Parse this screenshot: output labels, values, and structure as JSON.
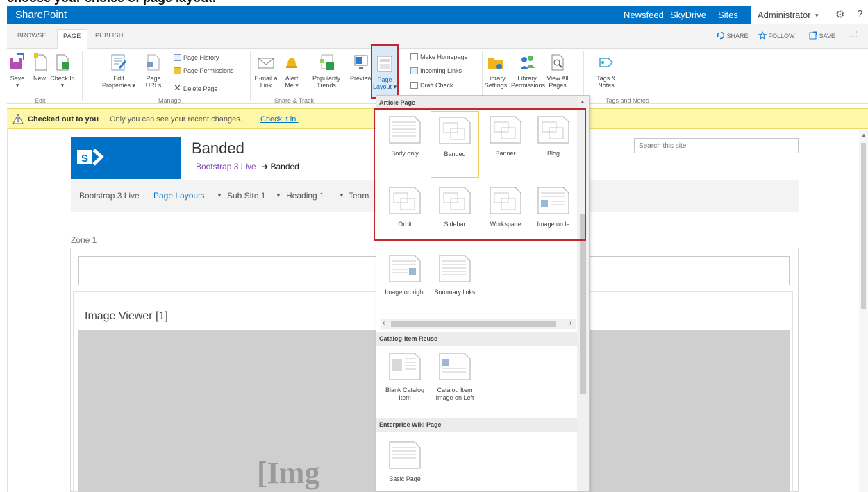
{
  "caption": "choose your choice of page layout.",
  "suite_bar": {
    "brand": "SharePoint",
    "links": [
      "Newsfeed",
      "SkyDrive",
      "Sites"
    ],
    "user": "Administrator",
    "user_caret": "▾",
    "gear": "⚙",
    "help": "?"
  },
  "ribbon_tabs": [
    "BROWSE",
    "PAGE",
    "PUBLISH"
  ],
  "top_actions": {
    "share": "SHARE",
    "follow": "FOLLOW",
    "save": "SAVE"
  },
  "ribbon": {
    "edit_group": {
      "save": "Save",
      "new": "New",
      "check_in": "Check In",
      "label": "Edit"
    },
    "manage_group": {
      "edit_properties": "Edit Properties",
      "page_urls": "Page URLs",
      "page_history": "Page History",
      "page_permissions": "Page Permissions",
      "delete_page": "Delete Page",
      "label": "Manage"
    },
    "share_group": {
      "email_link": "E-mail a Link",
      "alert_me": "Alert Me",
      "popularity_trends": "Popularity Trends",
      "label": "Share & Track"
    },
    "layout_group": {
      "preview": "Preview",
      "page_layout": "Page Layout",
      "make_homepage": "Make Homepage",
      "incoming_links": "Incoming Links",
      "draft_check": "Draft Check"
    },
    "library_group": {
      "library_settings": "Library Settings",
      "library_permissions": "Library Permissions",
      "view_all_pages": "View All Pages"
    },
    "tags_group": {
      "tags_notes": "Tags & Notes",
      "label": "Tags and Notes"
    }
  },
  "status": {
    "title": "Checked out to you",
    "message": "Only you can see your recent changes.",
    "link": "Check it in."
  },
  "site": {
    "title": "Banded",
    "breadcrumb_parent": "Bootstrap 3 Live",
    "breadcrumb_arrow": "➔",
    "breadcrumb_current": "Banded",
    "search_placeholder": "Search this site",
    "nav": [
      "Bootstrap 3 Live",
      "Page Layouts",
      "Sub Site 1",
      "Heading 1",
      "Team"
    ],
    "zone_label": "Zone 1",
    "webpart_title": "Image Viewer [1]",
    "image_placeholder": "[Img"
  },
  "page_layout_menu": {
    "sections": [
      "Article Page",
      "Catalog-Item Reuse",
      "Enterprise Wiki Page"
    ],
    "article_layouts": [
      "Body only",
      "Banded",
      "Banner",
      "Blog",
      "Orbit",
      "Sidebar",
      "Workspace",
      "Image on le",
      "Image on right",
      "Summary links"
    ],
    "catalog_layouts": [
      "Blank Catalog Item",
      "Catalog Item Image on Left"
    ],
    "wiki_layouts": [
      "Basic Page"
    ],
    "selected": "Banded"
  },
  "colors": {
    "suite_blue": "#0072c6",
    "status_yellow": "#fff7a8",
    "highlight_red": "#c0282d",
    "selected_border": "#f3cf63"
  }
}
